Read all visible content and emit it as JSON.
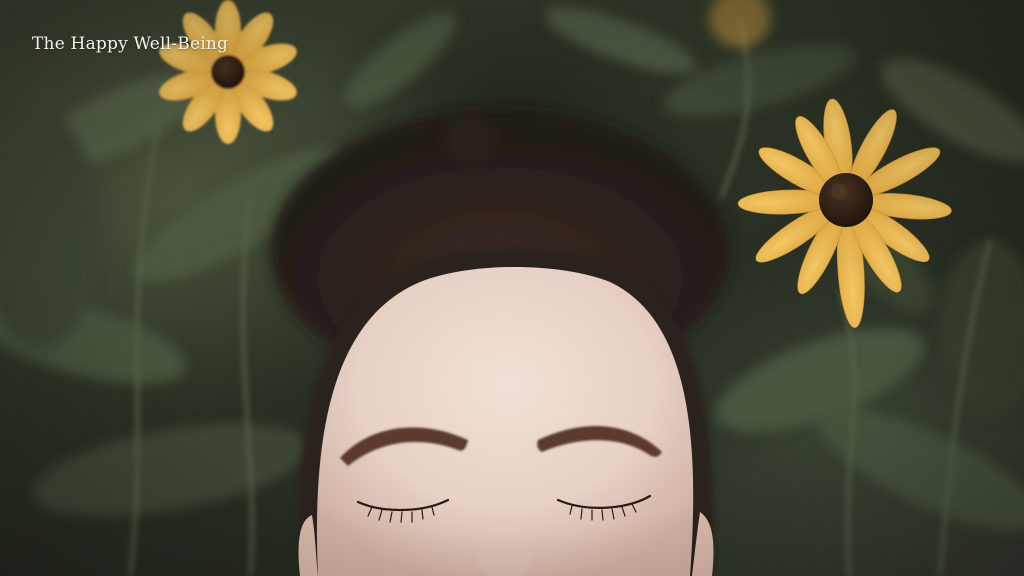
{
  "brand": {
    "title": "The Happy Well-Being"
  },
  "photo": {
    "subject": "woman-with-closed-eyes",
    "flower_icon": "black-eyed-susan-icon",
    "colors": {
      "foliage_dark": "#2a3124",
      "foliage_mid": "#4b5740",
      "leaf_light": "#5f6d52",
      "petal": "#e8b54a",
      "flower_center": "#2b1d12",
      "skin": "#e9d3c9",
      "hair": "#3a2a22",
      "brow": "#5b3b2f"
    }
  }
}
